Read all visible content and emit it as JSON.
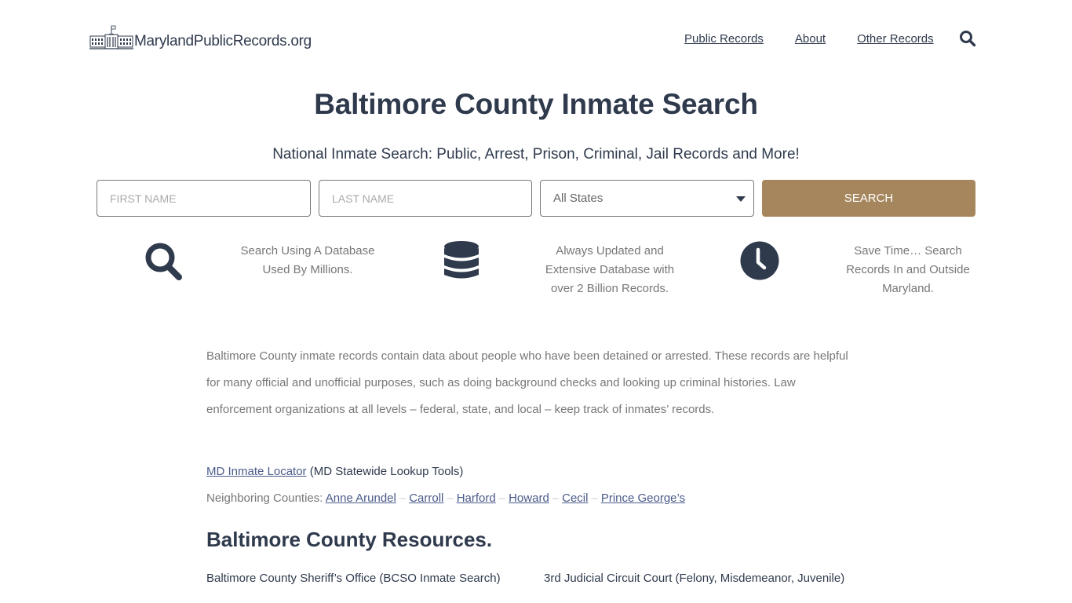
{
  "header": {
    "logo_text": "MarylandPublicRecords.org",
    "nav": [
      "Public Records",
      "About",
      "Other Records"
    ]
  },
  "hero": {
    "title": "Baltimore County Inmate Search",
    "subtitle": "National Inmate Search: Public, Arrest, Prison, Criminal, Jail Records and More!"
  },
  "search_form": {
    "first_name_placeholder": "FIRST NAME",
    "last_name_placeholder": "LAST NAME",
    "state_selected": "All States",
    "search_label": "SEARCH"
  },
  "features": [
    {
      "icon": "search-icon",
      "text_lines": [
        "Search Using A Database",
        "Used By Millions."
      ]
    },
    {
      "icon": "database-icon",
      "text_lines": [
        "Always Updated and",
        "Extensive Database with",
        "over 2 Billion Records."
      ]
    },
    {
      "icon": "clock-icon",
      "text_lines": [
        "Save Time… Search",
        "Records In and Outside",
        "Maryland."
      ]
    }
  ],
  "article": {
    "intro": "Baltimore County inmate records contain data about people who have been detained or arrested. These records are helpful for many official and unofficial purposes, such as doing background checks and looking up criminal histories. Law enforcement organizations at all levels – federal, state, and local – keep track of inmates’ records.",
    "locator_link": "MD Inmate Locator",
    "locator_suffix": " (MD Statewide Lookup Tools)",
    "neighbors_label": "Neighboring Counties: ",
    "neighbors": [
      "Anne Arundel",
      "Carroll",
      "Harford",
      "Howard",
      "Cecil",
      "Prince George’s"
    ],
    "resources_title": "Baltimore County Resources.",
    "resources": [
      "Baltimore County Sheriff’s Office (BCSO Inmate Search)",
      "3rd Judicial Circuit Court (Felony, Misdemeanor, Juvenile)"
    ]
  },
  "colors": {
    "primary_text": "#2f3a4d",
    "accent_button": "#a6865c",
    "muted_text": "#777777",
    "link": "#4a5b8a"
  }
}
